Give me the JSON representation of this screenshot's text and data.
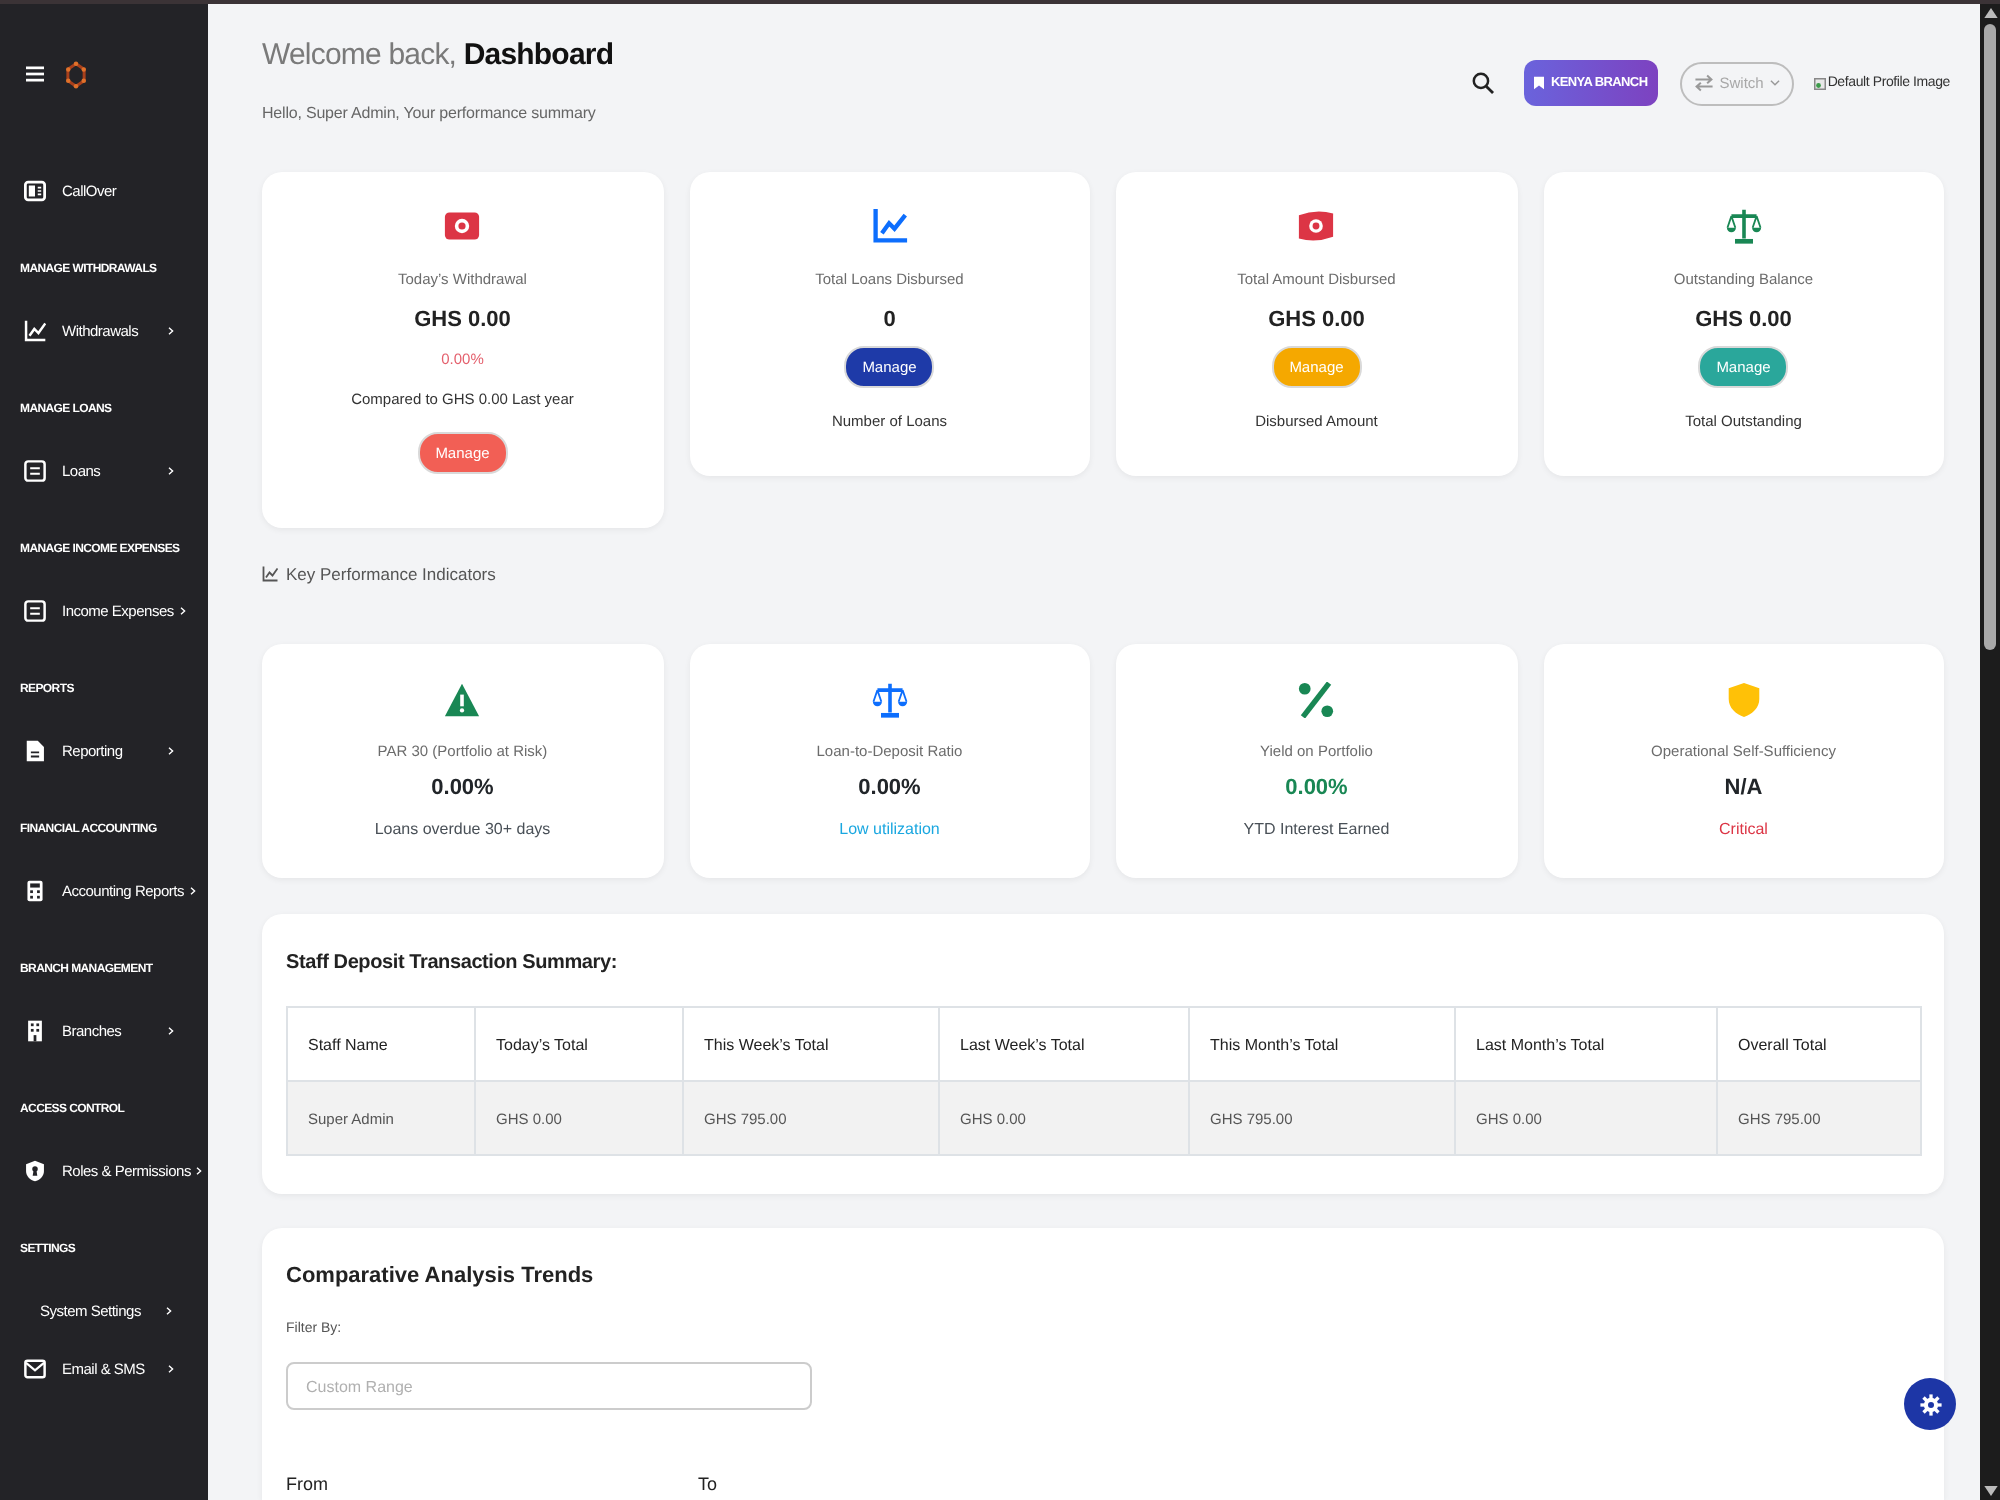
{
  "sidebar": {
    "sections": [
      {
        "items": [
          {
            "label": "CallOver",
            "icon": true,
            "submenu": false
          }
        ]
      },
      {
        "heading": "MANAGE WITHDRAWALS",
        "items": [
          {
            "label": "Withdrawals",
            "icon": true,
            "submenu": true
          }
        ]
      },
      {
        "heading": "MANAGE LOANS",
        "items": [
          {
            "label": "Loans",
            "icon": true,
            "submenu": true
          }
        ]
      },
      {
        "heading": "MANAGE INCOME EXPENSES",
        "items": [
          {
            "label": "Income Expenses",
            "icon": true,
            "submenu": true
          }
        ]
      },
      {
        "heading": "REPORTS",
        "items": [
          {
            "label": "Reporting",
            "icon": true,
            "submenu": true
          }
        ]
      },
      {
        "heading": "FINANCIAL ACCOUNTING",
        "items": [
          {
            "label": "Accounting Reports",
            "icon": true,
            "submenu": true
          }
        ]
      },
      {
        "heading": "BRANCH MANAGEMENT",
        "items": [
          {
            "label": "Branches",
            "icon": true,
            "submenu": true
          }
        ]
      },
      {
        "heading": "ACCESS CONTROL",
        "items": [
          {
            "label": "Roles & Permissions",
            "icon": true,
            "submenu": true
          }
        ]
      },
      {
        "heading": "SETTINGS",
        "items": [
          {
            "label": "System Settings",
            "icon": false,
            "submenu": true
          },
          {
            "label": "Email & SMS",
            "icon": true,
            "submenu": true
          }
        ]
      }
    ]
  },
  "header": {
    "title": "Welcome back, **Dashboard**",
    "subtitle": "Hello, Super Admin, Your performance summary",
    "branch_button": "KENYA BRANCH",
    "switch_button": "Switch",
    "profile_image_alt": "Default Profile Image"
  },
  "summary_cards": [
    {
      "kind": "trend",
      "color": "#dc3545",
      "label": "Today’s Withdrawal",
      "value": "GHS 0.00",
      "change": "0.00%",
      "caption": "Compared to GHS 0.00 Last year",
      "button": {
        "label": "Manage",
        "color": "#f25f55"
      }
    },
    {
      "kind": "basic",
      "color": "#0d6efd",
      "label": "Total Loans Disbursed",
      "value": "0",
      "button": {
        "label": "Manage",
        "color": "#1e3aa8"
      },
      "caption": "Number of Loans"
    },
    {
      "kind": "basic",
      "color": "#dc3545",
      "label": "Total Amount Disbursed",
      "value": "GHS 0.00",
      "button": {
        "label": "Manage",
        "color": "#f5a800"
      },
      "caption": "Disbursed Amount"
    },
    {
      "kind": "basic",
      "color": "#198754",
      "label": "Outstanding Balance",
      "value": "GHS 0.00",
      "button": {
        "label": "Manage",
        "color": "#2aa79b"
      },
      "caption": "Total Outstanding"
    }
  ],
  "kpi_title": "Key Performance Indicators",
  "kpis": [
    {
      "color": "#198754",
      "label": "PAR 30 (Portfolio at Risk)",
      "value": {
        "text": "0.00%",
        "color": "#212529"
      },
      "note": {
        "text": "Loans overdue 30+ days",
        "color": "#495057"
      }
    },
    {
      "color": "#0d6efd",
      "label": "Loan-to-Deposit Ratio",
      "value": {
        "text": "0.00%",
        "color": "#212529"
      },
      "note": {
        "text": "Low utilization",
        "color": "#1aa7e0"
      }
    },
    {
      "color": "#198754",
      "label": "Yield on Portfolio",
      "value": {
        "text": "0.00%",
        "color": "#198754"
      },
      "note": {
        "text": "YTD Interest Earned",
        "color": "#495057"
      }
    },
    {
      "color": "#ffc107",
      "label": "Operational Self-Sufficiency",
      "value": {
        "text": "N/A",
        "color": "#212529"
      },
      "note": {
        "text": "Critical",
        "color": "#dc3545"
      }
    }
  ],
  "staff_table": {
    "title": "Staff Deposit Transaction Summary:",
    "columns": [
      "Staff Name",
      "Today’s Total",
      "This Week’s Total",
      "Last Week’s Total",
      "This Month’s Total",
      "Last Month’s Total",
      "Overall Total"
    ],
    "rows": [
      [
        "Super Admin",
        "GHS 0.00",
        "GHS 795.00",
        "GHS 0.00",
        "GHS 795.00",
        "GHS 0.00",
        "GHS 795.00"
      ]
    ]
  },
  "comparative": {
    "title": "Comparative Analysis Trends",
    "filter_label": "Filter By:",
    "range_field": {
      "placeholder": "Custom Range"
    },
    "from_label": "From",
    "to_label": "To"
  }
}
